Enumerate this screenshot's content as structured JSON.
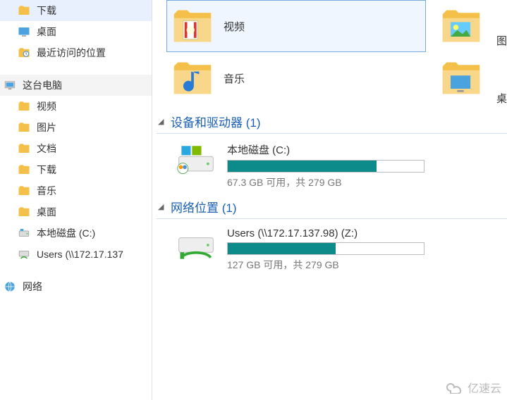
{
  "sidebar": {
    "quick": [
      {
        "label": "下载",
        "icon": "folder-download"
      },
      {
        "label": "桌面",
        "icon": "desktop"
      },
      {
        "label": "最近访问的位置",
        "icon": "recent"
      }
    ],
    "pcHeader": "这台电脑",
    "pcItems": [
      {
        "label": "视频",
        "icon": "folder"
      },
      {
        "label": "图片",
        "icon": "folder"
      },
      {
        "label": "文档",
        "icon": "folder"
      },
      {
        "label": "下载",
        "icon": "folder"
      },
      {
        "label": "音乐",
        "icon": "folder"
      },
      {
        "label": "桌面",
        "icon": "folder"
      },
      {
        "label": "本地磁盘 (C:)",
        "icon": "disk"
      },
      {
        "label": "Users (\\\\172.17.137",
        "icon": "net-drive"
      }
    ],
    "network": "网络"
  },
  "main": {
    "folders": [
      {
        "label": "视频",
        "extra": "图"
      },
      {
        "label": "音乐",
        "extra": "桌"
      }
    ],
    "groupDevices": {
      "title": "设备和驱动器 (1)",
      "drive": {
        "name": "本地磁盘 (C:)",
        "used_pct": 76,
        "stat": "67.3 GB 可用，共 279 GB"
      }
    },
    "groupNetwork": {
      "title": "网络位置 (1)",
      "drive": {
        "name": "Users (\\\\172.17.137.98) (Z:)",
        "used_pct": 55,
        "stat": "127 GB 可用，共 279 GB"
      }
    }
  },
  "watermark": "亿速云"
}
